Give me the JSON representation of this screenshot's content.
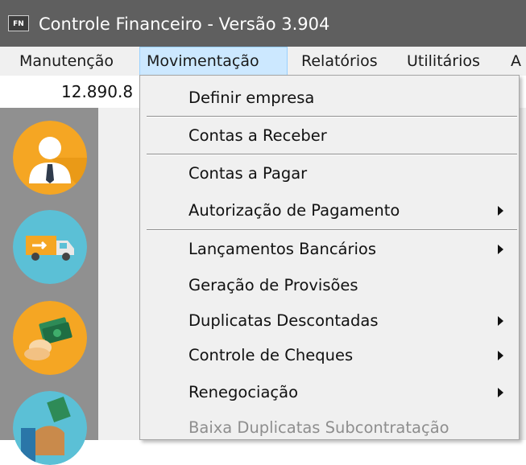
{
  "window": {
    "icon_text": "FN",
    "title": "Controle Financeiro - Versão 3.904"
  },
  "menubar": {
    "items": [
      {
        "label": "Manutenção"
      },
      {
        "label": "Movimentação"
      },
      {
        "label": "Relatórios"
      },
      {
        "label": "Utilitários"
      },
      {
        "label": "A"
      }
    ]
  },
  "status": {
    "balance": "12.890.8"
  },
  "sidebar": {
    "icons": [
      "user-icon",
      "delivery-truck-icon",
      "money-icon",
      "money-hand-icon"
    ]
  },
  "dropdown": {
    "items": [
      {
        "label": "Definir empresa",
        "submenu": false,
        "enabled": true
      },
      {
        "label": "Contas a Receber",
        "submenu": false,
        "enabled": true
      },
      {
        "label": "Contas a Pagar",
        "submenu": false,
        "enabled": true
      },
      {
        "label": "Autorização de Pagamento",
        "submenu": true,
        "enabled": true
      },
      {
        "label": "Lançamentos Bancários",
        "submenu": true,
        "enabled": true
      },
      {
        "label": "Geração de Provisões",
        "submenu": false,
        "enabled": true
      },
      {
        "label": "Duplicatas Descontadas",
        "submenu": true,
        "enabled": true
      },
      {
        "label": "Controle de Cheques",
        "submenu": true,
        "enabled": true
      },
      {
        "label": "Renegociação",
        "submenu": true,
        "enabled": true
      },
      {
        "label": "Baixa Duplicatas Subcontratação",
        "submenu": false,
        "enabled": false
      }
    ]
  },
  "colors": {
    "titlebar": "#5f5f5f",
    "menu_highlight": "#cce8ff",
    "sidebar": "#909090",
    "icon_orange": "#f5a623",
    "icon_teal": "#5bc0d6"
  }
}
